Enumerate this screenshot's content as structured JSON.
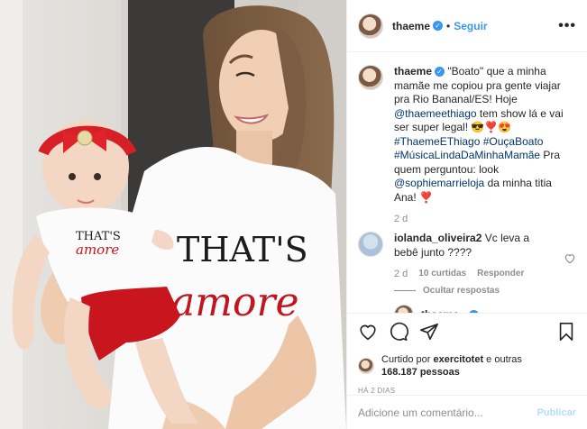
{
  "post": {
    "username": "thaeme",
    "follow_label": "Seguir",
    "more_label": "•••",
    "verified_glyph": "✓"
  },
  "photo": {
    "shirt_left_text": "THAT'S",
    "shirt_left_text2": "amore",
    "shirt_right_text": "THAT'S",
    "shirt_right_text2": "amore"
  },
  "caption": {
    "username": "thaeme",
    "text_1": " \"Boato\" que a minha mamãe me copiou pra gente viajar pra Rio Bananal/ES! Hoje ",
    "mention_1": "@thaemeethiago",
    "text_2": " tem show lá e vai ser super legal! 😎❣️😍 ",
    "hashtag_1": "#ThaemeEThiago",
    "hashtag_2": "#OuçaBoato",
    "hashtag_3": "#MúsicaLindaDaMinhaMamãe",
    "text_3": " Pra quem perguntou: look ",
    "mention_2": "@sophiemarrieloja",
    "text_4": " da minha titia Ana! ❣️",
    "age": "2 d"
  },
  "comment": {
    "username": "iolanda_oliveira2",
    "text": " Vc leva a bebê junto ????",
    "age": "2 d",
    "likes": "10 curtidas",
    "reply_label": "Responder",
    "hide_replies_label": "Ocultar respostas"
  },
  "partial_comment": {
    "username": "thaeme"
  },
  "likes": {
    "prefix": "Curtido por ",
    "user": "exercitotet",
    "middle": " e outras ",
    "count": "168.187 pessoas"
  },
  "timestamp": "HÁ 2 DIAS",
  "add_comment": {
    "placeholder": "Adicione um comentário...",
    "publish_label": "Publicar"
  },
  "colors": {
    "link": "#003569",
    "accent": "#3897f0",
    "publish_disabled": "#b2dffc",
    "muted": "#8e8e8e",
    "glitter_red": "#c0161f"
  },
  "icons": [
    "heart-icon",
    "comment-icon",
    "share-icon",
    "bookmark-icon",
    "more-icon",
    "verified-icon"
  ]
}
